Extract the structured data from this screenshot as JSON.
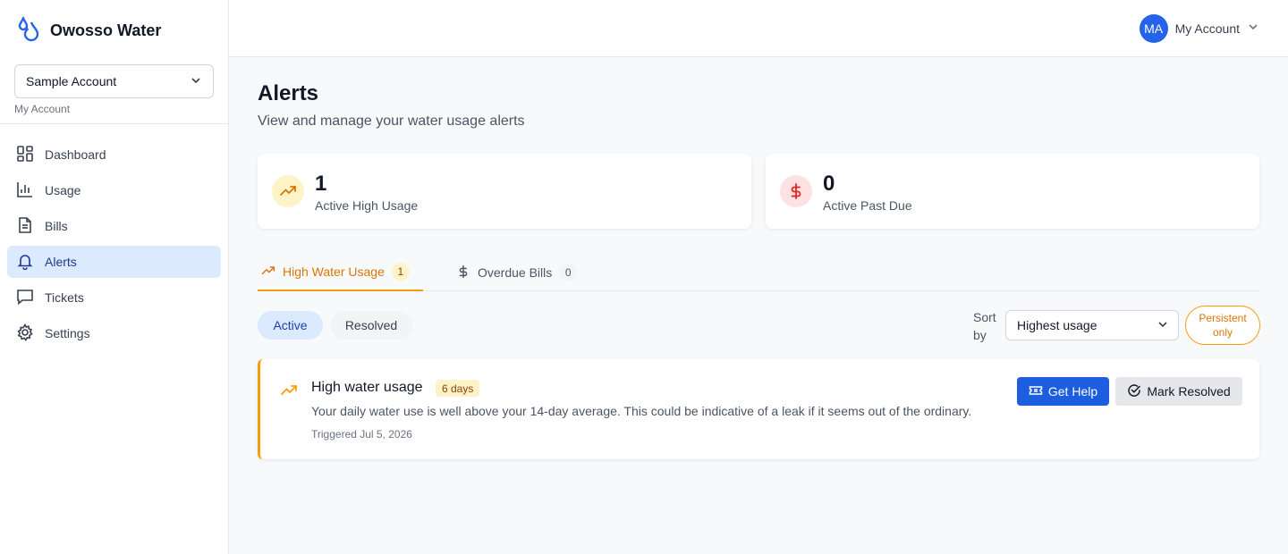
{
  "app": {
    "name": "Owosso Water",
    "logo_icon": "water-drops-icon",
    "brand_color": "#2563eb"
  },
  "account_switcher": {
    "selected": "Sample Account",
    "caption": "My Account"
  },
  "sidebar": {
    "items": [
      {
        "label": "Dashboard",
        "icon": "dashboard-icon",
        "active": false
      },
      {
        "label": "Usage",
        "icon": "bar-chart-icon",
        "active": false
      },
      {
        "label": "Bills",
        "icon": "document-icon",
        "active": false
      },
      {
        "label": "Alerts",
        "icon": "bell-icon",
        "active": true
      },
      {
        "label": "Tickets",
        "icon": "message-icon",
        "active": false
      },
      {
        "label": "Settings",
        "icon": "gear-icon",
        "active": false
      }
    ]
  },
  "header": {
    "avatar_initials": "MA",
    "account_label": "My Account"
  },
  "page": {
    "title": "Alerts",
    "subtitle": "View and manage your water usage alerts"
  },
  "stats": [
    {
      "value": "1",
      "label": "Active High Usage",
      "icon": "trending-up-icon",
      "color": "#f59e0b"
    },
    {
      "value": "0",
      "label": "Active Past Due",
      "icon": "dollar-icon",
      "color": "#dc2626"
    }
  ],
  "tabs": [
    {
      "label": "High Water Usage",
      "count": "1",
      "icon": "trending-up-icon",
      "active": true
    },
    {
      "label": "Overdue Bills",
      "count": "0",
      "icon": "dollar-icon",
      "active": false
    }
  ],
  "filters": {
    "active_label": "Active",
    "resolved_label": "Resolved",
    "selected": "Active"
  },
  "sort": {
    "label": "Sort by",
    "selected": "Highest usage"
  },
  "persistent_label": "Persistent only",
  "alerts": [
    {
      "title": "High water usage",
      "duration": "6 days",
      "description": "Your daily water use is well above your 14-day average. This could be indicative of a leak if it seems out of the ordinary.",
      "triggered": "Triggered Jul 5, 2026",
      "help_label": "Get Help",
      "resolve_label": "Mark Resolved",
      "accent": "#f59e0b"
    }
  ]
}
